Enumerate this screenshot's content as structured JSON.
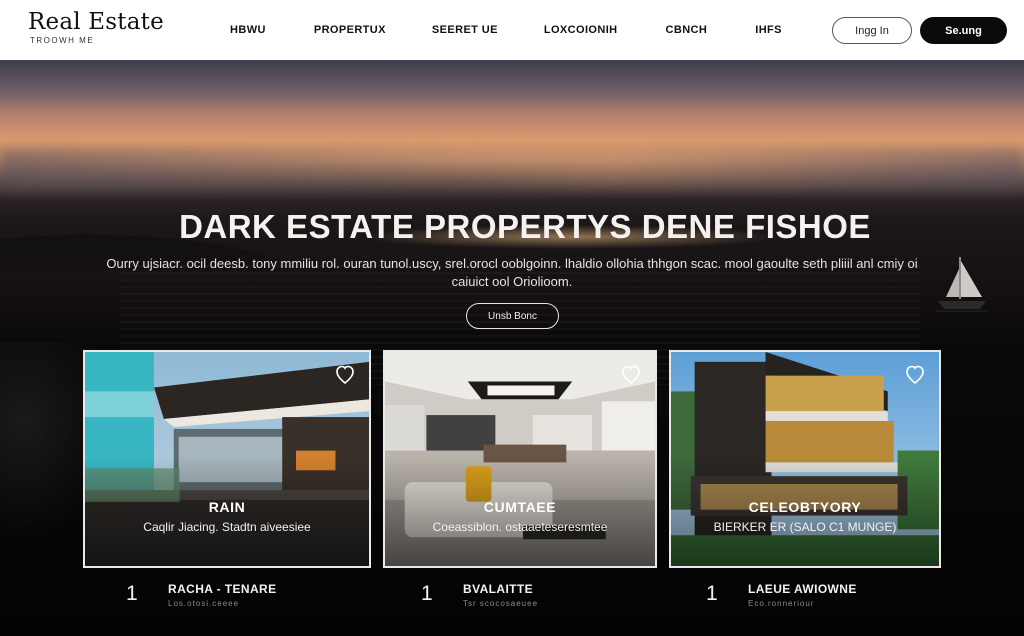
{
  "header": {
    "brand_title": "Real Estate",
    "brand_tagline": "TROOWH ME",
    "nav": [
      "HBWU",
      "PROPERTUX",
      "SEERET UE",
      "LOXCOIONIH",
      "CBNCH",
      "IHFS"
    ],
    "login_label": "Ingg In",
    "signup_label": "Se",
    "signup_label_rest": ".ung"
  },
  "hero": {
    "title": "DARK ESTATE PROPERTYS DENE FISHOE",
    "subtitle": "Ourry ujsiacr. ocil deesb. tony mmiliu rol. ouran tunol.uscy, srel.orocl ooblgoinn. lhaldio ollohia thhgon scac. mool gaoulte seth pliiil anl cmiy oi caiuict ool Oriolioom.",
    "cta_label": "Unsb Bonc"
  },
  "listings": [
    {
      "title": "RAIN",
      "caption": "Caqlir Jiacing. Stadtn aiveesiee",
      "number": "1",
      "name": "RACHA - TENARE",
      "sub": "Los.otosi.ceeee"
    },
    {
      "title": "CUMTAEE",
      "caption": "Coeassiblon. ostaaeteseresmtee",
      "number": "1",
      "name": "BVALAITTE",
      "sub": "Tsr scocosaeuee"
    },
    {
      "title": "CELEOBTYORY",
      "caption": "BIERKER ER (SALO C1 MUNGE)",
      "number": "1",
      "name": "LAEUE AWIOWNE",
      "sub": "Eco.ronneriour"
    }
  ],
  "colors": {
    "accent": "#0b0b0b",
    "card_border": "#e9e9e9",
    "hero_text": "#f4f1ee"
  },
  "icons": {
    "favorite": "heart-outline-icon",
    "sailboat": "sailboat-icon"
  }
}
